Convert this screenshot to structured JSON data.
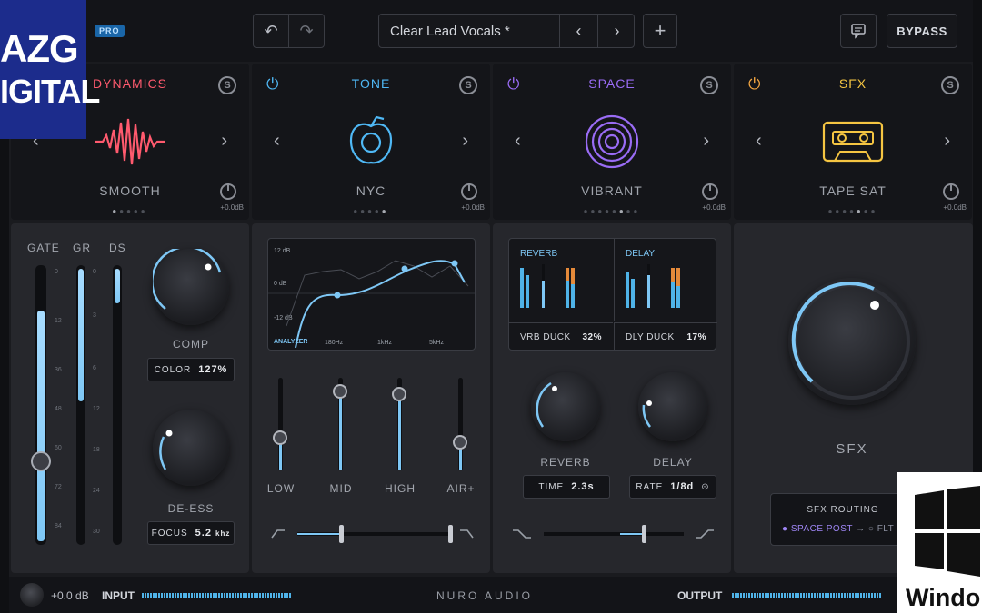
{
  "overlay": {
    "logo_line1": "AZG",
    "logo_line2": "IGITAL",
    "windows_word": "Windo"
  },
  "topbar": {
    "pro_badge": "PRO",
    "undo_icon": "↶",
    "redo_icon": "↷",
    "preset_name": "Clear Lead Vocals *",
    "prev_icon": "‹",
    "next_icon": "›",
    "add_icon": "+",
    "bypass_label": "BYPASS"
  },
  "modules": [
    {
      "title": "DYNAMICS",
      "preset": "SMOOTH",
      "color": "#ff5a6e",
      "gain": "+0.0dB",
      "active_dot": 0
    },
    {
      "title": "TONE",
      "preset": "NYC",
      "color": "#4fb8f5",
      "gain": "+0.0dB",
      "active_dot": 4
    },
    {
      "title": "SPACE",
      "preset": "VIBRANT",
      "color": "#9a6cf5",
      "gain": "+0.0dB",
      "active_dot": 5
    },
    {
      "title": "SFX",
      "preset": "TAPE SAT",
      "color": "#f5c542",
      "gain": "+0.0dB",
      "active_dot": 4
    }
  ],
  "dynamics": {
    "meter_labels": [
      "GATE",
      "GR",
      "DS"
    ],
    "gate_scale": [
      "0",
      "12",
      "36",
      "48",
      "60",
      "72",
      "84"
    ],
    "gr_scale": [
      "0",
      "3",
      "6",
      "12",
      "18",
      "24",
      "30"
    ],
    "comp_label": "COMP",
    "color_label": "COLOR",
    "color_value": "127%",
    "deess_label": "DE-ESS",
    "focus_label": "FOCUS",
    "focus_value": "5.2",
    "focus_unit": "khz"
  },
  "tone": {
    "db_labels": [
      "12 dB",
      "0 dB",
      "-12 dB"
    ],
    "analyzer_label": "ANALYZER",
    "freq_labels": [
      "180Hz",
      "1kHz",
      "5kHz"
    ],
    "bands": [
      "LOW",
      "MID",
      "HIGH",
      "AIR+"
    ],
    "band_levels": [
      0.35,
      0.85,
      0.82,
      0.3
    ]
  },
  "space": {
    "reverb_title": "REVERB",
    "delay_title": "DELAY",
    "vrb_duck_label": "VRB DUCK",
    "vrb_duck_value": "32%",
    "dly_duck_label": "DLY DUCK",
    "dly_duck_value": "17%",
    "reverb_knob_label": "REVERB",
    "delay_knob_label": "DELAY",
    "time_label": "TIME",
    "time_value": "2.3s",
    "rate_label": "RATE",
    "rate_value": "1/8d"
  },
  "sfx": {
    "knob_label": "SFX",
    "routing_title": "SFX ROUTING",
    "routing_active": "SPACE POST",
    "routing_other": "FLT"
  },
  "bottombar": {
    "input_gain": "+0.0 dB",
    "input_label": "INPUT",
    "brand": "NURO AUDIO",
    "output_label": "OUTPUT"
  },
  "colors": {
    "accent_blue": "#7ec7f5",
    "dynamics": "#ff5a6e",
    "tone": "#4fb8f5",
    "space": "#9a6cf5",
    "sfx": "#f5c542"
  }
}
